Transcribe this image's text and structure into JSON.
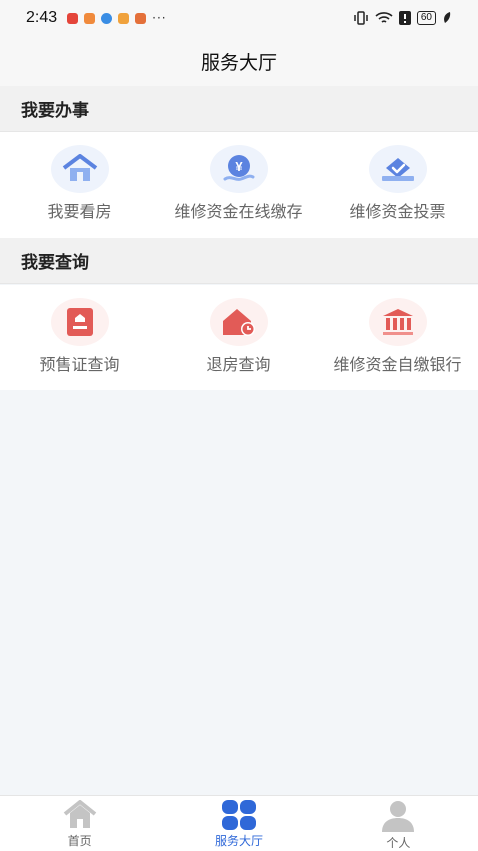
{
  "status": {
    "time": "2:43",
    "dots": "···",
    "battery": "60"
  },
  "header": {
    "title": "服务大厅"
  },
  "sections": [
    {
      "title": "我要办事",
      "items": [
        {
          "label": "我要看房",
          "icon": "house-icon"
        },
        {
          "label": "维修资金在线缴存",
          "icon": "yuan-payment-icon"
        },
        {
          "label": "维修资金投票",
          "icon": "vote-box-icon"
        }
      ]
    },
    {
      "title": "我要查询",
      "items": [
        {
          "label": "预售证查询",
          "icon": "certificate-icon"
        },
        {
          "label": "退房查询",
          "icon": "house-clock-icon"
        },
        {
          "label": "维修资金自缴银行",
          "icon": "bank-icon"
        }
      ]
    }
  ],
  "tabbar": {
    "tabs": [
      {
        "label": "首页",
        "icon": "home-icon"
      },
      {
        "label": "服务大厅",
        "icon": "grid-icon"
      },
      {
        "label": "个人",
        "icon": "user-icon"
      }
    ],
    "active": "服务大厅"
  },
  "colors": {
    "accent": "#2f68d8",
    "icon_blue": "#5b83e0",
    "icon_red": "#e25b57"
  }
}
